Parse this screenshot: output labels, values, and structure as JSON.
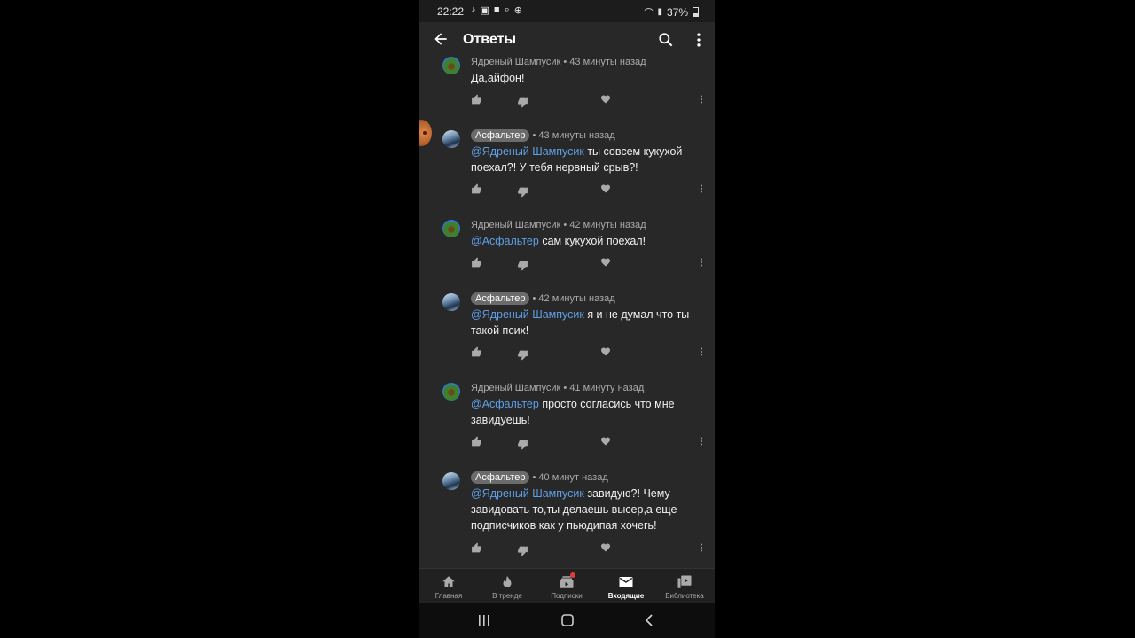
{
  "status_bar": {
    "time": "22:22",
    "battery": "37%"
  },
  "app_bar": {
    "title": "Ответы"
  },
  "comments": [
    {
      "author": "Ядреный Шампусик",
      "time": "43 минуты назад",
      "mention": "",
      "text": "Да,айфон!",
      "avatar": "yadreny-avatar"
    },
    {
      "author": "Асфальтер",
      "time": "43 минуты назад",
      "mention": "@Ядреный Шампусик",
      "text": " ты совсем кукухой поехал?! У тебя нервный срыв?!",
      "avatar": "asfalter-avatar"
    },
    {
      "author": "Ядреный Шампусик",
      "time": "42 минуты назад",
      "mention": "@Асфальтер",
      "text": " сам кукухой поехал!",
      "avatar": "yadreny-avatar"
    },
    {
      "author": "Асфальтер",
      "time": "42 минуты назад",
      "mention": "@Ядреный Шампусик",
      "text": " я и не думал что ты такой псих!",
      "avatar": "asfalter-avatar"
    },
    {
      "author": "Ядреный Шампусик",
      "time": "41 минуту назад",
      "mention": "@Асфальтер",
      "text": " просто согласись что мне завидуешь!",
      "avatar": "yadreny-avatar"
    },
    {
      "author": "Асфальтер",
      "time": "40 минут назад",
      "mention": "@Ядреный Шампусик",
      "text": " завидую?! Чему завидовать то,ты делаешь высер,а еще подписчиков как у пьюдипая хочегь!",
      "avatar": "asfalter-avatar"
    }
  ],
  "bottom_nav": [
    {
      "label": "Главная",
      "icon": "home-icon"
    },
    {
      "label": "В тренде",
      "icon": "flame-icon"
    },
    {
      "label": "Подписки",
      "icon": "subscriptions-icon"
    },
    {
      "label": "Входящие",
      "icon": "mail-icon",
      "active": true
    },
    {
      "label": "Библиотека",
      "icon": "library-icon"
    }
  ],
  "colors": {
    "background": "#282828",
    "mention": "#5ea0e8",
    "chip": "#6b6b6b",
    "notification_dot": "#e53935"
  }
}
